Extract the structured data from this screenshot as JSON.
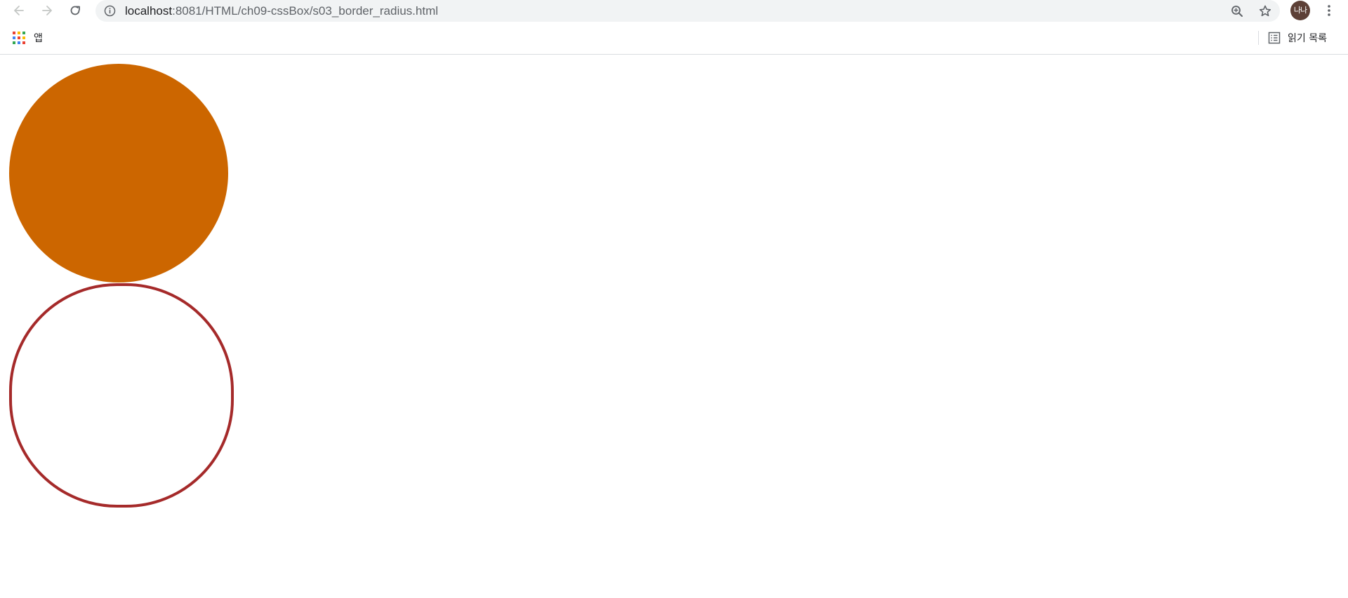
{
  "browser": {
    "url_host": "localhost",
    "url_rest": ":8081/HTML/ch09-cssBox/s03_border_radius.html",
    "avatar_text": "나나",
    "icons": {
      "back": "back-arrow-icon",
      "forward": "forward-arrow-icon",
      "reload": "reload-icon",
      "info": "info-icon",
      "zoom": "zoom-icon",
      "bookmark": "star-icon",
      "menu": "kebab-menu-icon",
      "apps": "apps-grid-icon",
      "reading_list": "reading-list-icon"
    }
  },
  "bookmarks_bar": {
    "apps_label": "앱",
    "reading_list_label": "읽기 목록"
  },
  "page": {
    "filled_circle_color": "#cc6600",
    "outline_circle_color": "#a52a2a",
    "background": "#ffffff"
  }
}
